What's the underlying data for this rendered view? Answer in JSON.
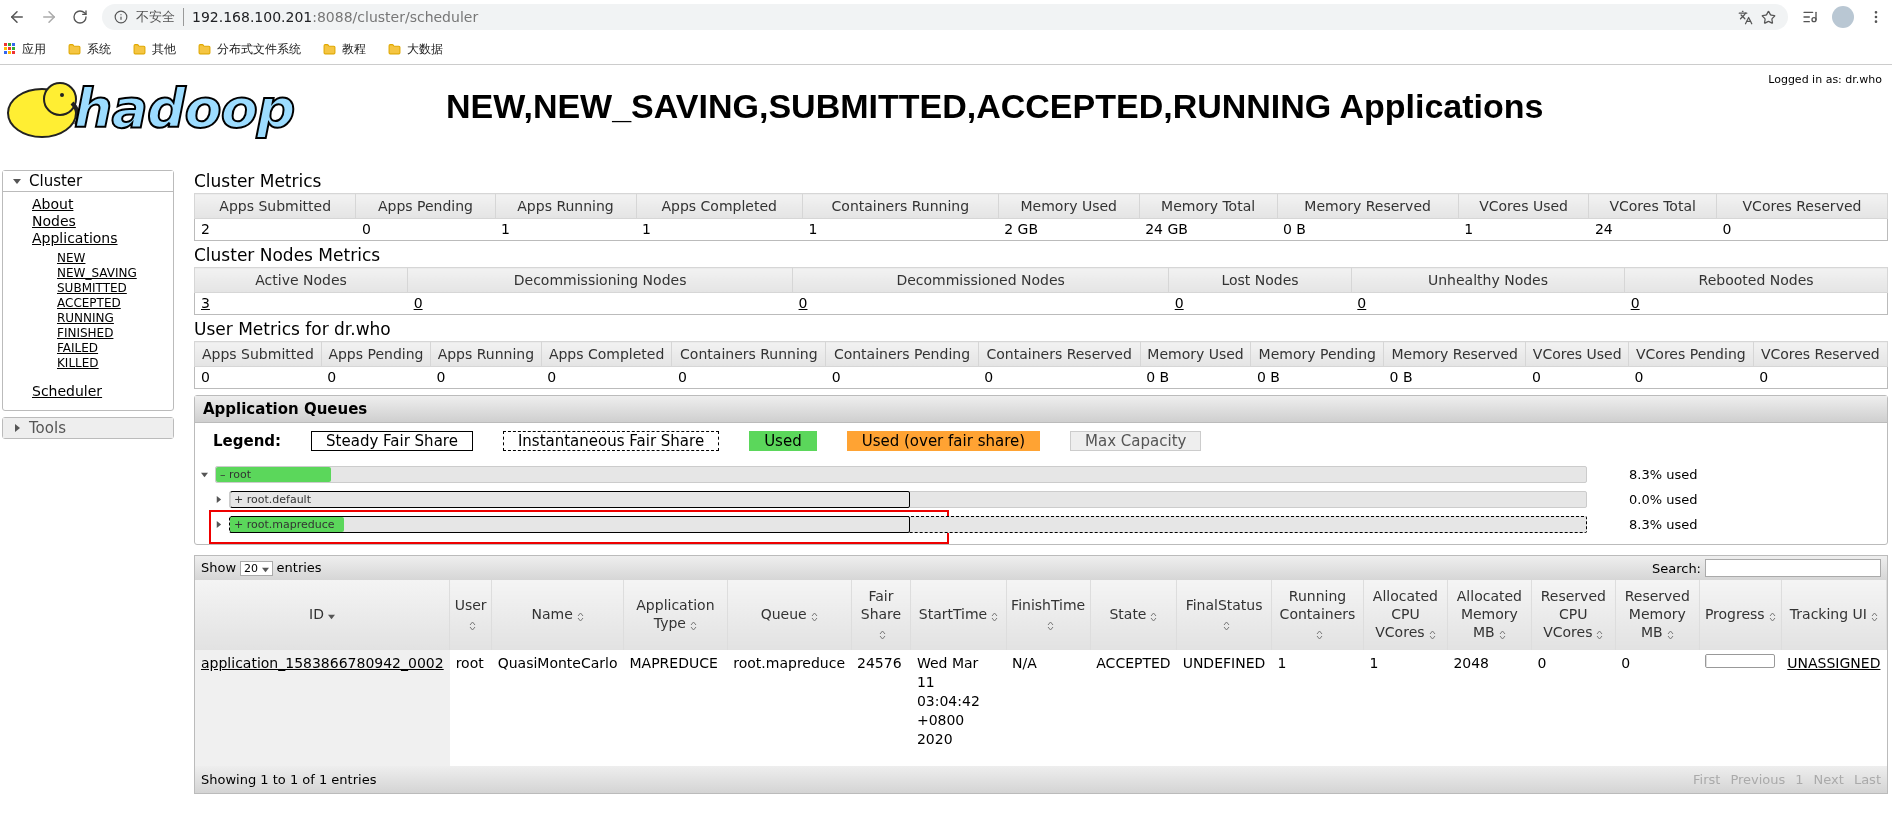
{
  "browser": {
    "security": "不安全",
    "url_host": "192.168.100.201",
    "url_rest": ":8088/cluster/scheduler",
    "bookmarks": [
      {
        "label": "应用",
        "kind": "apps"
      },
      {
        "label": "系统",
        "kind": "folder"
      },
      {
        "label": "其他",
        "kind": "folder"
      },
      {
        "label": "分布式文件系统",
        "kind": "folder"
      },
      {
        "label": "教程",
        "kind": "folder"
      },
      {
        "label": "大数据",
        "kind": "folder"
      }
    ]
  },
  "header": {
    "logo": "hadoop",
    "title": "NEW,NEW_SAVING,SUBMITTED,ACCEPTED,RUNNING Applications",
    "logged_in": "Logged in as: dr.who"
  },
  "sidebar": [
    {
      "label": "Cluster",
      "expanded": true,
      "items": [
        {
          "label": "About"
        },
        {
          "label": "Nodes"
        },
        {
          "label": "Applications",
          "children": [
            {
              "label": "NEW"
            },
            {
              "label": "NEW_SAVING"
            },
            {
              "label": "SUBMITTED"
            },
            {
              "label": "ACCEPTED"
            },
            {
              "label": "RUNNING"
            },
            {
              "label": "FINISHED"
            },
            {
              "label": "FAILED"
            },
            {
              "label": "KILLED"
            }
          ]
        },
        {
          "label": "Scheduler"
        }
      ]
    },
    {
      "label": "Tools",
      "expanded": false
    }
  ],
  "metrics": [
    {
      "title": "Cluster Metrics",
      "linked": false,
      "columns": [
        "Apps Submitted",
        "Apps Pending",
        "Apps Running",
        "Apps Completed",
        "Containers Running",
        "Memory Used",
        "Memory Total",
        "Memory Reserved",
        "VCores Used",
        "VCores Total",
        "VCores Reserved"
      ],
      "values": [
        "2",
        "0",
        "1",
        "1",
        "1",
        "2 GB",
        "24 GB",
        "0 B",
        "1",
        "24",
        "0"
      ]
    },
    {
      "title": "Cluster Nodes Metrics",
      "linked": true,
      "columns": [
        "Active Nodes",
        "Decommissioning Nodes",
        "Decommissioned Nodes",
        "Lost Nodes",
        "Unhealthy Nodes",
        "Rebooted Nodes"
      ],
      "values": [
        "3",
        "0",
        "0",
        "0",
        "0",
        "0"
      ]
    },
    {
      "title": "User Metrics for dr.who",
      "linked": false,
      "columns": [
        "Apps Submitted",
        "Apps Pending",
        "Apps Running",
        "Apps Completed",
        "Containers Running",
        "Containers Pending",
        "Containers Reserved",
        "Memory Used",
        "Memory Pending",
        "Memory Reserved",
        "VCores Used",
        "VCores Pending",
        "VCores Reserved"
      ],
      "values": [
        "0",
        "0",
        "0",
        "0",
        "0",
        "0",
        "0",
        "0 B",
        "0 B",
        "0 B",
        "0",
        "0",
        "0"
      ]
    }
  ],
  "queues": {
    "title": "Application Queues",
    "legend_label": "Legend:",
    "legend": [
      {
        "label": "Steady Fair Share",
        "kind": "steady"
      },
      {
        "label": "Instantaneous Fair Share",
        "kind": "instant"
      },
      {
        "label": "Used",
        "kind": "used"
      },
      {
        "label": "Used (over fair share)",
        "kind": "over"
      },
      {
        "label": "Max Capacity",
        "kind": "max"
      }
    ],
    "items": [
      {
        "name": "root",
        "toggle": "–",
        "kind": "root",
        "expanded": true,
        "level": 0.083,
        "instantaneous": false,
        "highlighted": false,
        "used": "8.3% used"
      },
      {
        "name": "root.default",
        "toggle": "+",
        "kind": "leaf",
        "expanded": false,
        "level": 0,
        "instantaneous": false,
        "highlighted": false,
        "used": "0.0% used"
      },
      {
        "name": "root.mapreduce",
        "toggle": "+",
        "kind": "leaf",
        "expanded": false,
        "level": 0.083,
        "instantaneous": true,
        "highlighted": true,
        "used": "8.3% used"
      }
    ]
  },
  "apps": {
    "show": "Show",
    "page_size": "20",
    "entries": "entries",
    "search_label": "Search:",
    "columns": [
      {
        "label": "ID",
        "sorted": true
      },
      {
        "label": "User",
        "sorted": false
      },
      {
        "label": "Name",
        "sorted": false
      },
      {
        "label": "Application Type",
        "sorted": false
      },
      {
        "label": "Queue",
        "sorted": false
      },
      {
        "label": "Fair Share",
        "sorted": false
      },
      {
        "label": "StartTime",
        "sorted": false
      },
      {
        "label": "FinishTime",
        "sorted": false
      },
      {
        "label": "State",
        "sorted": false
      },
      {
        "label": "FinalStatus",
        "sorted": false
      },
      {
        "label": "Running Containers",
        "sorted": false
      },
      {
        "label": "Allocated CPU VCores",
        "sorted": false
      },
      {
        "label": "Allocated Memory MB",
        "sorted": false
      },
      {
        "label": "Reserved CPU VCores",
        "sorted": false
      },
      {
        "label": "Reserved Memory MB",
        "sorted": false
      },
      {
        "label": "Progress",
        "sorted": false
      },
      {
        "label": "Tracking UI",
        "sorted": false
      }
    ],
    "rows": [
      {
        "cells": [
          "application_1583866780942_0002",
          "root",
          "QuasiMonteCarlo",
          "MAPREDUCE",
          "root.mapreduce",
          "24576",
          "Wed Mar 11 03:04:42 +0800 2020",
          "N/A",
          "ACCEPTED",
          "UNDEFINED",
          "1",
          "1",
          "2048",
          "0",
          "0"
        ],
        "level": 0,
        "tracking": "UNASSIGNED"
      }
    ],
    "info": "Showing 1 to 1 of 1 entries",
    "pager": [
      {
        "label": "First",
        "disabled": true
      },
      {
        "label": "Previous",
        "disabled": true
      },
      {
        "label": "1",
        "disabled": true
      },
      {
        "label": "Next",
        "disabled": true
      },
      {
        "label": "Last",
        "disabled": true
      }
    ]
  }
}
